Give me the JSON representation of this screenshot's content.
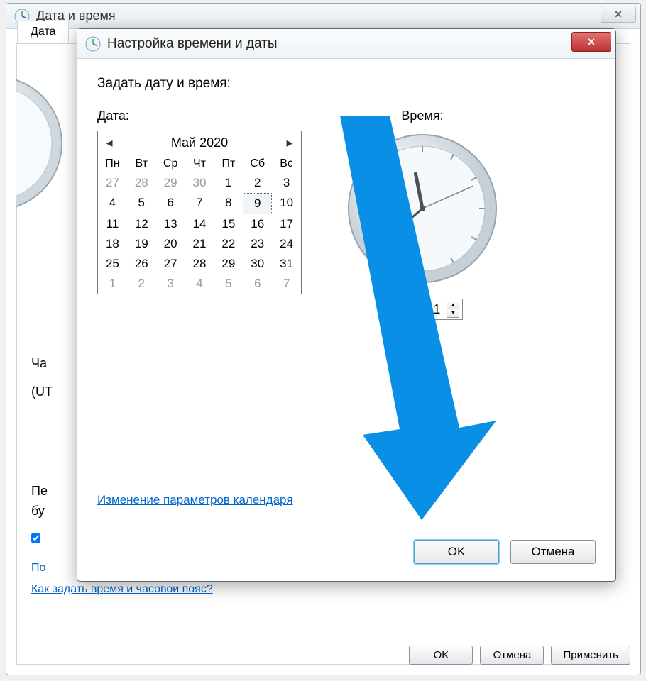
{
  "parent": {
    "title": "Дата и время",
    "tab_label": "Дата",
    "chas_label": "Ча",
    "ut_label": "(UТ",
    "pe_label": "Пе",
    "bu_label": "бу",
    "link1": "По",
    "link2": "Как задать время и часовои пояс?",
    "buttons": {
      "ok": "OK",
      "cancel": "Отмена",
      "apply": "Применить"
    }
  },
  "modal": {
    "title": "Настройка времени и даты",
    "heading": "Задать дату и время:",
    "date_label": "Дата:",
    "time_label": "Время:",
    "calendar": {
      "month_label": "Май 2020",
      "dow": [
        "Пн",
        "Вт",
        "Ср",
        "Чт",
        "Пт",
        "Сб",
        "Вс"
      ],
      "weeks": [
        [
          {
            "d": 27,
            "o": true
          },
          {
            "d": 28,
            "o": true
          },
          {
            "d": 29,
            "o": true
          },
          {
            "d": 30,
            "o": true
          },
          {
            "d": 1
          },
          {
            "d": 2
          },
          {
            "d": 3
          }
        ],
        [
          {
            "d": 4
          },
          {
            "d": 5
          },
          {
            "d": 6
          },
          {
            "d": 7
          },
          {
            "d": 8
          },
          {
            "d": 9,
            "sel": true
          },
          {
            "d": 10
          }
        ],
        [
          {
            "d": 11
          },
          {
            "d": 12
          },
          {
            "d": 13
          },
          {
            "d": 14
          },
          {
            "d": 15
          },
          {
            "d": 16
          },
          {
            "d": 17
          }
        ],
        [
          {
            "d": 18
          },
          {
            "d": 19
          },
          {
            "d": 20
          },
          {
            "d": 21
          },
          {
            "d": 22
          },
          {
            "d": 23
          },
          {
            "d": 24
          }
        ],
        [
          {
            "d": 25
          },
          {
            "d": 26
          },
          {
            "d": 27
          },
          {
            "d": 28
          },
          {
            "d": 29
          },
          {
            "d": 30
          },
          {
            "d": 31
          }
        ],
        [
          {
            "d": 1,
            "o": true
          },
          {
            "d": 2,
            "o": true
          },
          {
            "d": 3,
            "o": true
          },
          {
            "d": 4,
            "o": true
          },
          {
            "d": 5,
            "o": true
          },
          {
            "d": 6,
            "o": true
          },
          {
            "d": 7,
            "o": true
          }
        ]
      ]
    },
    "time_value": "23:38:11",
    "clock": {
      "hour": 23,
      "minute": 38,
      "second": 11
    },
    "link": "Изменение параметров календаря",
    "buttons": {
      "ok": "OK",
      "cancel": "Отмена"
    }
  }
}
